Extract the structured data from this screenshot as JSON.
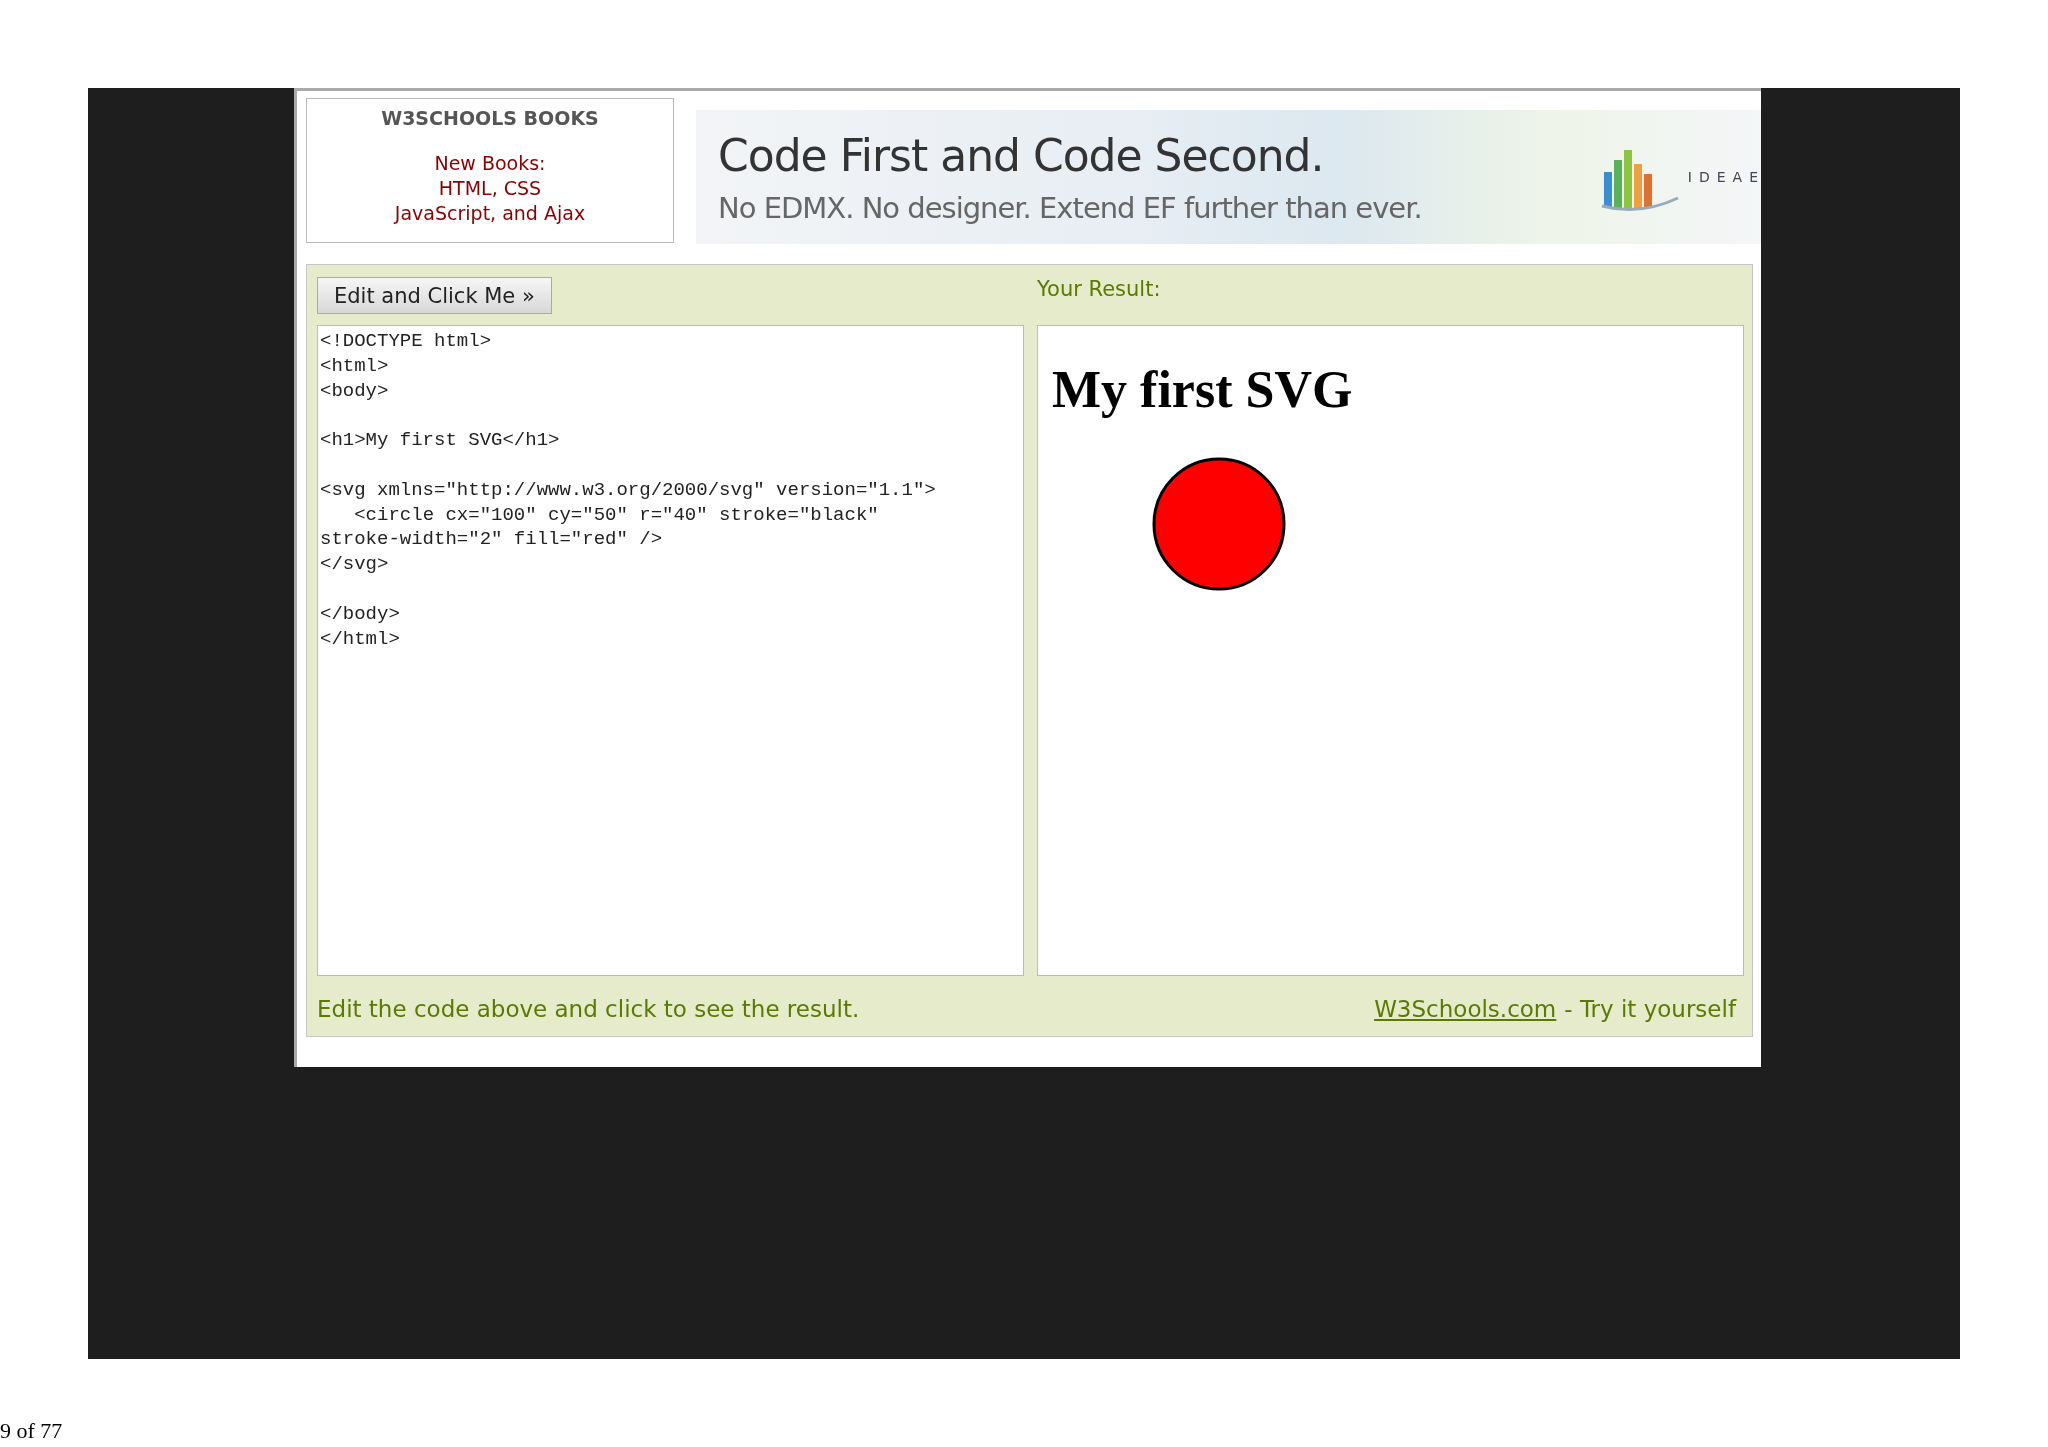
{
  "books": {
    "title": "W3SCHOOLS BOOKS",
    "lines": [
      "New Books:",
      "HTML, CSS",
      "JavaScript, and Ajax"
    ]
  },
  "banner": {
    "headline": "Code First and Code Second.",
    "tagline": "No EDMX. No designer. Extend EF further than ever.",
    "brand": "IDEAE"
  },
  "editor": {
    "button": "Edit and Click Me »",
    "result_label": "Your Result:",
    "code": "<!DOCTYPE html>\n<html>\n<body>\n\n<h1>My first SVG</h1>\n\n<svg xmlns=\"http://www.w3.org/2000/svg\" version=\"1.1\">\n   <circle cx=\"100\" cy=\"50\" r=\"40\" stroke=\"black\"\nstroke-width=\"2\" fill=\"red\" />\n</svg>\n\n</body>\n</html>",
    "result_heading": "My first SVG"
  },
  "footer": {
    "hint": "Edit the code above and click to see the result.",
    "link": "W3Schools.com",
    "suffix": "- Try it yourself"
  },
  "page_number": "9 of 77"
}
